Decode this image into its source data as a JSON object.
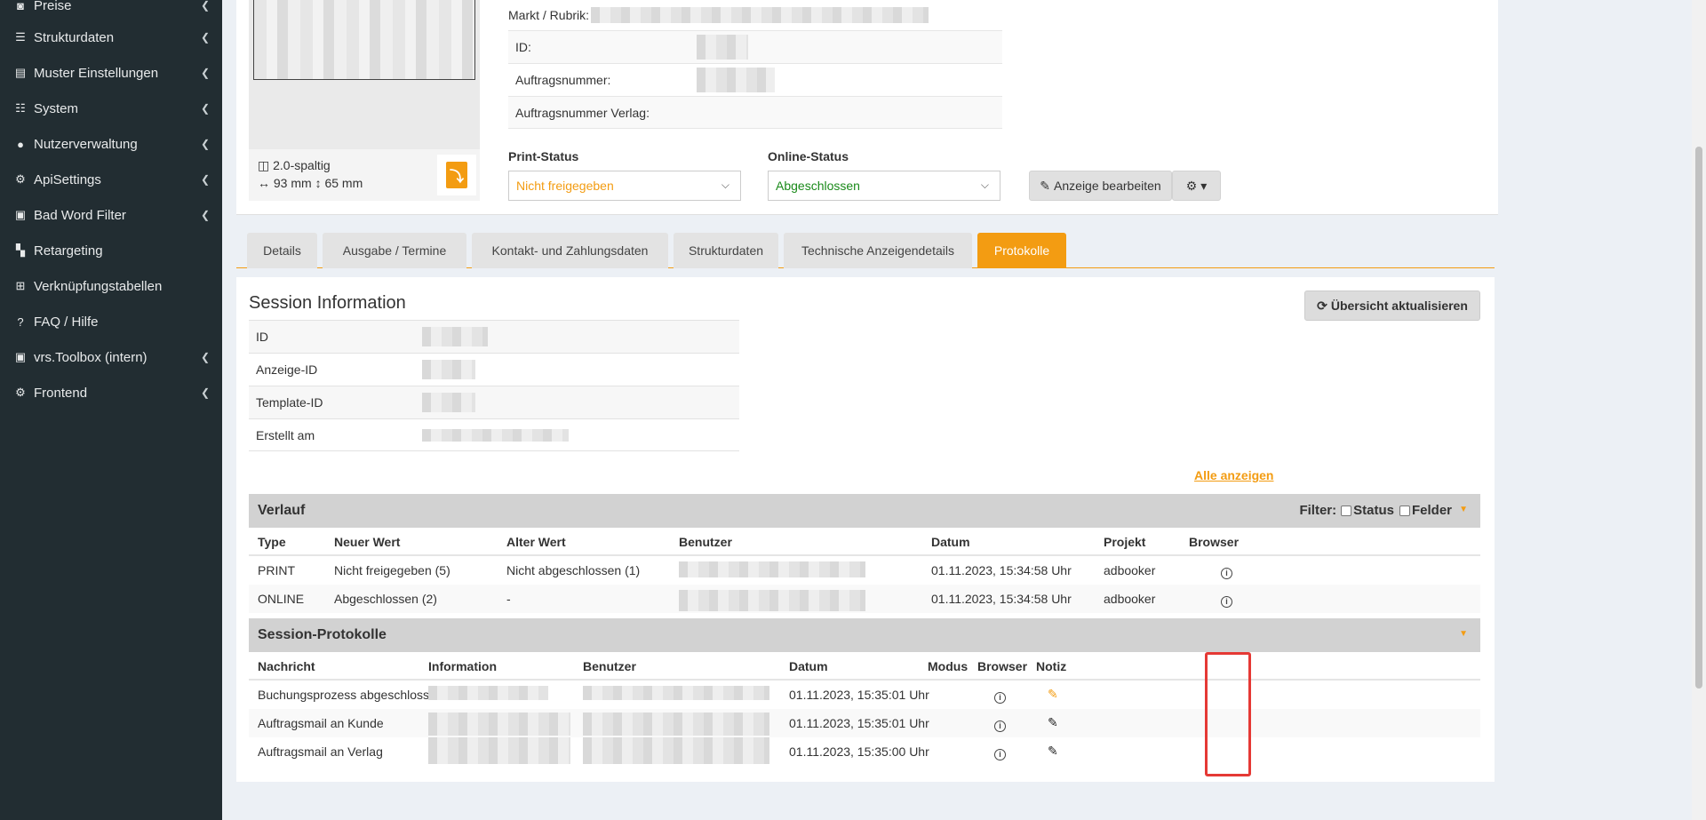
{
  "sidebar": {
    "items": [
      {
        "label": "Preise",
        "icon": "camera-icon",
        "glyph": "◙",
        "chevron": true
      },
      {
        "label": "Strukturdaten",
        "icon": "list-icon",
        "glyph": "☰",
        "chevron": true
      },
      {
        "label": "Muster Einstellungen",
        "icon": "file-icon",
        "glyph": "▤",
        "chevron": true
      },
      {
        "label": "System",
        "icon": "tasks-icon",
        "glyph": "☷",
        "chevron": true
      },
      {
        "label": "Nutzerverwaltung",
        "icon": "user-icon",
        "glyph": "●",
        "chevron": true
      },
      {
        "label": "ApiSettings",
        "icon": "gears-icon",
        "glyph": "⚙",
        "chevron": true
      },
      {
        "label": "Bad Word Filter",
        "icon": "lock-icon",
        "glyph": "▣",
        "chevron": true
      },
      {
        "label": "Retargeting",
        "icon": "cart-icon",
        "glyph": "▚",
        "chevron": false
      },
      {
        "label": "Verknüpfungstabellen",
        "icon": "sitemap-icon",
        "glyph": "⊞",
        "chevron": false
      },
      {
        "label": "FAQ / Hilfe",
        "icon": "question-icon",
        "glyph": "?",
        "chevron": false
      },
      {
        "label": "vrs.Toolbox (intern)",
        "icon": "lock-icon",
        "glyph": "▣",
        "chevron": true
      },
      {
        "label": "Frontend",
        "icon": "gears-icon",
        "glyph": "⚙",
        "chevron": true
      }
    ]
  },
  "ad": {
    "columns_label": "2.0-spaltig",
    "size_label": "↔ 93 mm ↕ 65 mm",
    "info": [
      {
        "key": "Markt / Rubrik:"
      },
      {
        "key": "ID:"
      },
      {
        "key": "Auftragsnummer:"
      },
      {
        "key": "Auftragsnummer Verlag:"
      }
    ],
    "print_status_label": "Print-Status",
    "print_status_value": "Nicht freigegeben",
    "online_status_label": "Online-Status",
    "online_status_value": "Abgeschlossen",
    "edit_button": "Anzeige bearbeiten",
    "colors": {
      "print": "#f39c12",
      "online": "#1a8a1a"
    }
  },
  "tabs": [
    {
      "label": "Details",
      "active": false
    },
    {
      "label": "Ausgabe / Termine",
      "active": false
    },
    {
      "label": "Kontakt- und Zahlungsdaten",
      "active": false
    },
    {
      "label": "Strukturdaten",
      "active": false
    },
    {
      "label": "Technische Anzeigendetails",
      "active": false
    },
    {
      "label": "Protokolle",
      "active": true
    }
  ],
  "session": {
    "title": "Session Information",
    "refresh_button": "Übersicht aktualisieren",
    "rows": [
      "ID",
      "Anzeige-ID",
      "Template-ID",
      "Erstellt am"
    ],
    "show_all": "Alle anzeigen"
  },
  "verlauf": {
    "title": "Verlauf",
    "filter_label": "Filter:",
    "filter_status": "Status",
    "filter_felder": "Felder",
    "headers": [
      "Type",
      "Neuer Wert",
      "Alter Wert",
      "Benutzer",
      "Datum",
      "Projekt",
      "Browser"
    ],
    "rows": [
      {
        "type": "PRINT",
        "neu": "Nicht freigegeben (5)",
        "alt": "Nicht abgeschlossen (1)",
        "datum": "01.11.2023, 15:34:58 Uhr",
        "projekt": "adbooker"
      },
      {
        "type": "ONLINE",
        "neu": "Abgeschlossen (2)",
        "alt": "-",
        "datum": "01.11.2023, 15:34:58 Uhr",
        "projekt": "adbooker"
      }
    ]
  },
  "protokolle": {
    "title": "Session-Protokolle",
    "headers": [
      "Nachricht",
      "Information",
      "Benutzer",
      "Datum",
      "Modus",
      "Browser",
      "Notiz"
    ],
    "rows": [
      {
        "nachricht": "Buchungsprozess abgeschlossen",
        "datum": "01.11.2023, 15:35:01 Uhr",
        "note_color": "orange"
      },
      {
        "nachricht": "Auftragsmail an Kunde",
        "datum": "01.11.2023, 15:35:01 Uhr",
        "note_color": "black"
      },
      {
        "nachricht": "Auftragsmail an Verlag",
        "datum": "01.11.2023, 15:35:00 Uhr",
        "note_color": "black"
      }
    ]
  }
}
